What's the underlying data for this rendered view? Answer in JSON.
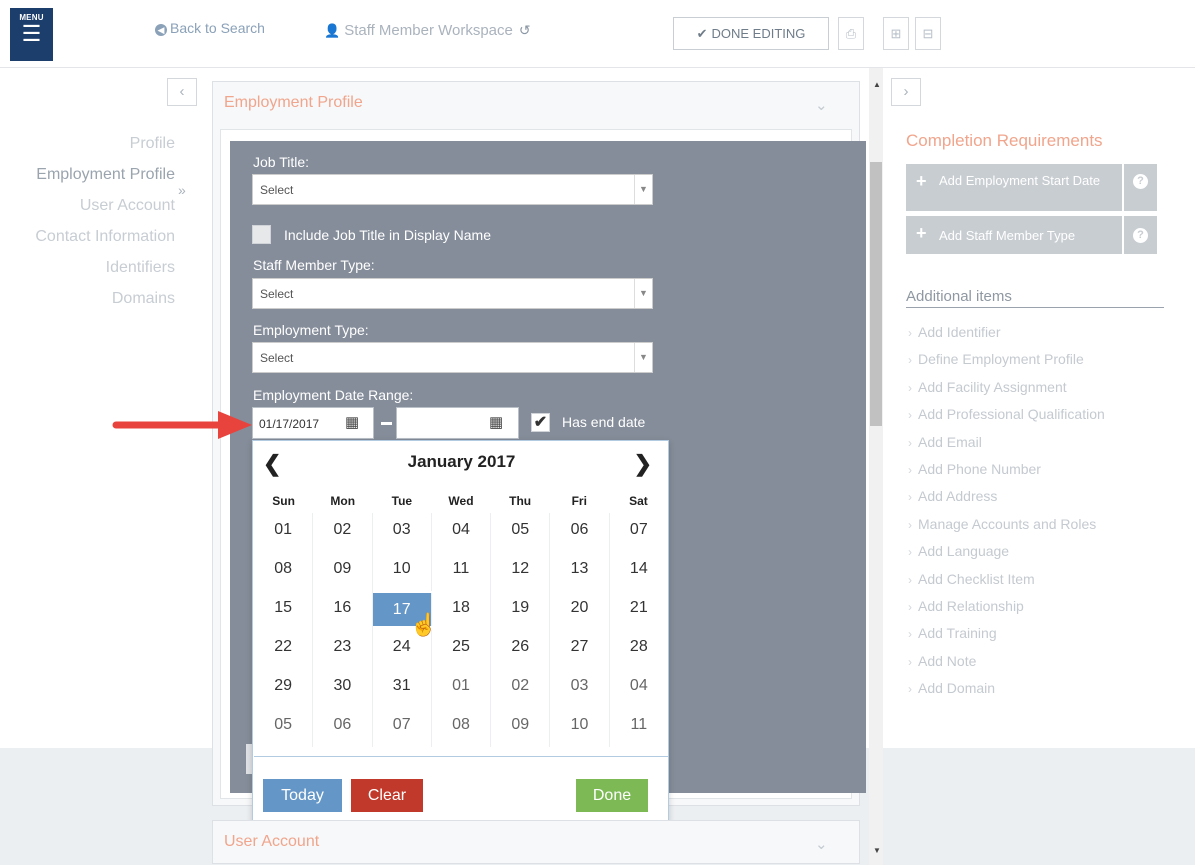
{
  "header": {
    "menu_label": "MENU",
    "back_link": "Back to Search",
    "workspace_title": "Staff Member Workspace",
    "done_editing": "DONE EDITING"
  },
  "left_nav": {
    "items": [
      "Profile",
      "Employment Profile",
      "User Account",
      "Contact Information",
      "Identifiers",
      "Domains"
    ]
  },
  "panel": {
    "title": "Employment Profile",
    "job_title_label": "Job Title:",
    "job_title_value": "Select",
    "include_job_title_label": "Include Job Title in Display Name",
    "staff_type_label": "Staff Member Type:",
    "staff_type_value": "Select",
    "employment_type_label": "Employment Type:",
    "employment_type_value": "Select",
    "date_range_label": "Employment Date Range:",
    "start_date": "01/17/2017",
    "end_date": "",
    "has_end_date_label": "Has end date",
    "has_end_date_checked": true
  },
  "calendar": {
    "month_title": "January 2017",
    "weekdays": [
      "Sun",
      "Mon",
      "Tue",
      "Wed",
      "Thu",
      "Fri",
      "Sat"
    ],
    "weeks": [
      [
        "01",
        "02",
        "03",
        "04",
        "05",
        "06",
        "07"
      ],
      [
        "08",
        "09",
        "10",
        "11",
        "12",
        "13",
        "14"
      ],
      [
        "15",
        "16",
        "17",
        "18",
        "19",
        "20",
        "21"
      ],
      [
        "22",
        "23",
        "24",
        "25",
        "26",
        "27",
        "28"
      ],
      [
        "29",
        "30",
        "31",
        "01",
        "02",
        "03",
        "04"
      ],
      [
        "05",
        "06",
        "07",
        "08",
        "09",
        "10",
        "11"
      ]
    ],
    "selected_day": "17",
    "today_label": "Today",
    "clear_label": "Clear",
    "done_label": "Done",
    "colors": {
      "today": "#6496c8",
      "clear": "#c0392b",
      "done": "#7dba55",
      "selected": "#6496c8"
    }
  },
  "user_account_panel": {
    "title": "User Account"
  },
  "requirements": {
    "title": "Completion Requirements",
    "items": [
      "Add Employment Start Date",
      "Add Staff Member Type"
    ]
  },
  "additional": {
    "title": "Additional items",
    "items": [
      "Add Identifier",
      "Define Employment Profile",
      "Add Facility Assignment",
      "Add Professional Qualification",
      "Add Email",
      "Add Phone Number",
      "Add Address",
      "Manage Accounts and Roles",
      "Add Language",
      "Add Checklist Item",
      "Add Relationship",
      "Add Training",
      "Add Note",
      "Add Domain"
    ]
  }
}
